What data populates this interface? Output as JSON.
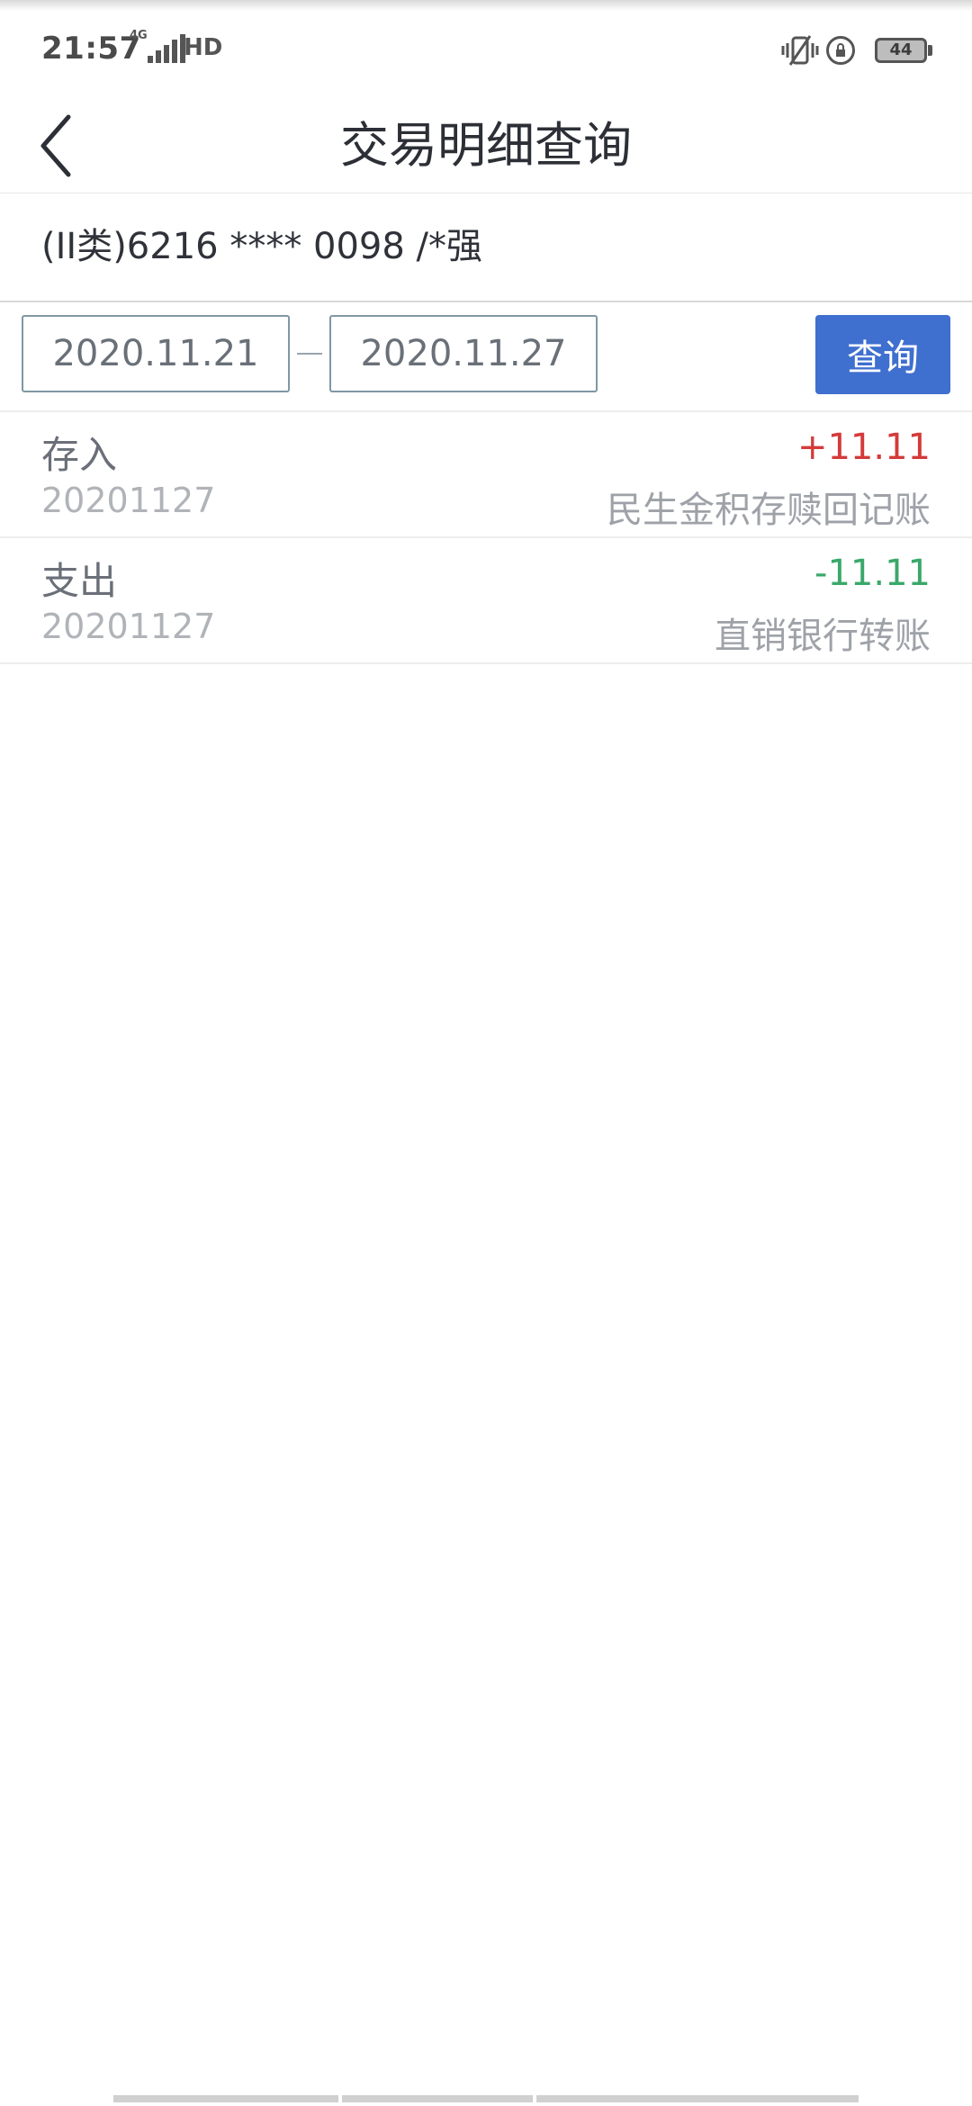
{
  "status_bar": {
    "time": "21:57",
    "network": "4G",
    "hd_label": "HD",
    "battery": "44",
    "icons": [
      "signal-icon",
      "hd-icon",
      "vibrate-icon",
      "rotation-lock-icon",
      "battery-icon"
    ]
  },
  "header": {
    "title": "交易明细查询",
    "back_icon": "chevron-left-icon"
  },
  "account": {
    "label": "(II类)6216 **** 0098 /*强"
  },
  "query": {
    "start_date": "2020.11.21",
    "end_date": "2020.11.27",
    "button_label": "查询"
  },
  "transactions": [
    {
      "type": "存入",
      "date": "20201127",
      "amount": "+11.11",
      "description": "民生金积存赎回记账"
    },
    {
      "type": "支出",
      "date": "20201127",
      "amount": "-11.11",
      "description": "直销银行转账"
    }
  ],
  "colors": {
    "accent": "#3f6fcf",
    "income": "#d43a3a",
    "expense": "#3aa86a"
  }
}
